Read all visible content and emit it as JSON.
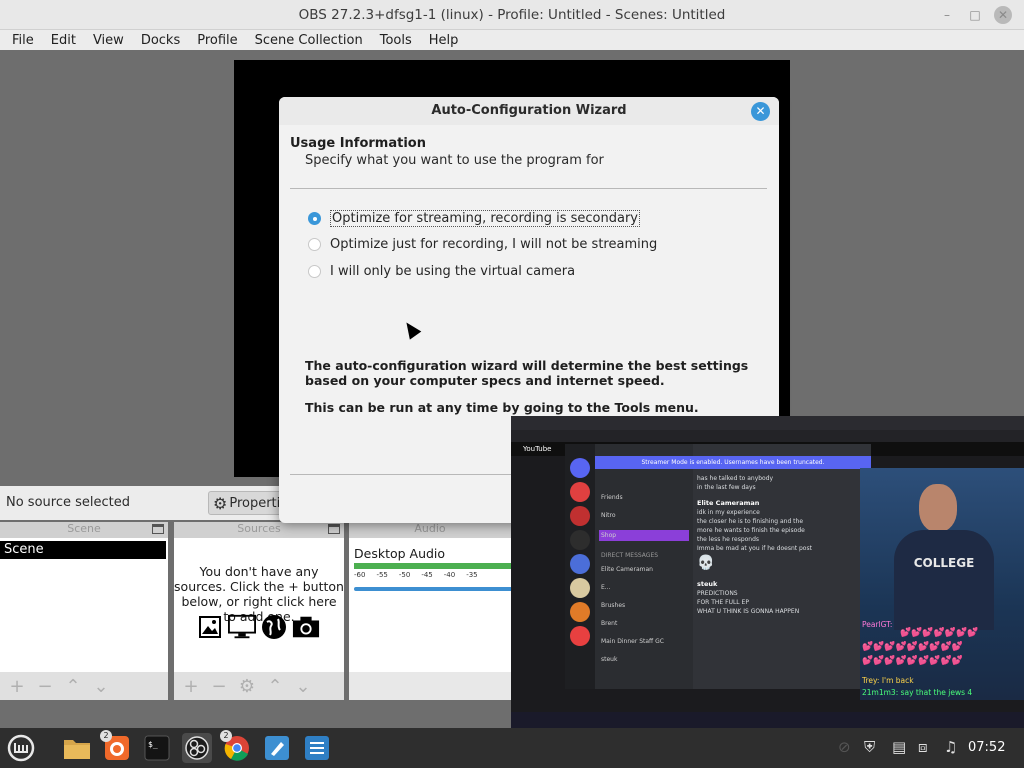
{
  "window": {
    "title": "OBS 27.2.3+dfsg1-1 (linux) - Profile: Untitled - Scenes: Untitled",
    "min_glyph": "–",
    "max_glyph": "□",
    "close_glyph": "✕"
  },
  "menubar": [
    "File",
    "Edit",
    "View",
    "Docks",
    "Profile",
    "Scene Collection",
    "Tools",
    "Help"
  ],
  "context_bar": {
    "no_source": "No source selected",
    "properties_label": "Properti"
  },
  "docks": {
    "scenes": {
      "header": "Scene",
      "items": [
        "Scene"
      ]
    },
    "sources": {
      "header": "Sources",
      "empty_text": "You don't have any sources. Click the + button below, or right click here to add one."
    },
    "mixer": {
      "header": "Audio",
      "label": "Desktop Audio",
      "scale": [
        "-60",
        "-55",
        "-50",
        "-45",
        "-40",
        "-35"
      ]
    }
  },
  "dialog": {
    "title": "Auto-Configuration Wizard",
    "heading": "Usage Information",
    "subheading": "Specify what you want to use the program for",
    "options": [
      {
        "label": "Optimize for streaming, recording is secondary",
        "selected": true
      },
      {
        "label": "Optimize just for recording, I will not be streaming",
        "selected": false
      },
      {
        "label": "I will only be using the virtual camera",
        "selected": false
      }
    ],
    "info1": "The auto-configuration wizard will determine the best settings based on your computer specs and internet speed.",
    "info2": "This can be run at any time by going to the Tools menu."
  },
  "overlay": {
    "yt_label": "YouTube",
    "discord_banner": "Streamer Mode is enabled. Usernames have been truncated.",
    "channels": [
      "Friends",
      "Nitro",
      "Shop",
      "DIRECT MESSAGES",
      "Elite Cameraman",
      "E...",
      "Brushes",
      "Brent",
      "Main Dinner Staff GC",
      "steuk"
    ],
    "messages": [
      {
        "name": "",
        "lines": [
          "has he talked to anybody",
          "in the last few days"
        ]
      },
      {
        "name": "Elite Cameraman",
        "lines": [
          "idk in my experience",
          "the closer he is to finishing and the",
          "more he wants to finish the episode",
          "the less he responds",
          "Imma be mad at you if he doesnt post"
        ]
      },
      {
        "name": "steuk",
        "lines": [
          "PREDICTIONS",
          "FOR THE FULL EP",
          "WHAT U THINK IS GONNA HAPPEN"
        ]
      }
    ],
    "shirt_text": "COLLEGE",
    "chat": [
      {
        "text": "PearlGT:",
        "color": "#ff7ad9"
      },
      {
        "text": "Trey: I'm back",
        "color": "#ffd54a"
      },
      {
        "text": "21m1m3: say that the jews 4",
        "color": "#4aff7a"
      }
    ]
  },
  "taskbar": {
    "firefox_badge": "2",
    "chrome_badge": "2",
    "clock": "07:52"
  },
  "colors": {
    "accent": "#3a97d9",
    "preview_bg": "#000000",
    "taskbar": "#2e2e2e",
    "discord": "#5865f2"
  }
}
